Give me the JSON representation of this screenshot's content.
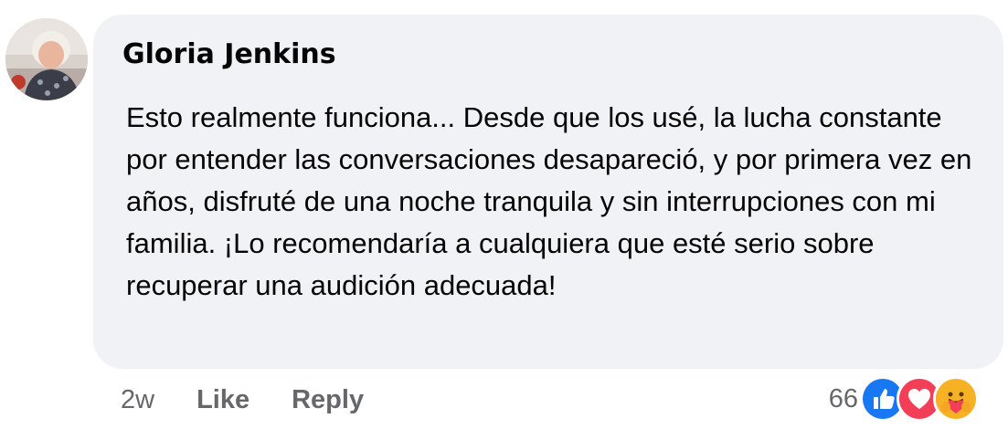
{
  "comment": {
    "author": "Gloria Jenkins",
    "avatar_icon": "profile-photo",
    "text": "Esto realmente funciona... Desde que los usé, la lucha constante por entender las conversaciones desapareció, y por primera vez en años, disfruté de una noche tranquila y sin interrupciones con mi familia. ¡Lo recomendaría a cualquiera que esté serio sobre recuperar una audición adecuada!",
    "timestamp": "2w",
    "like_label": "Like",
    "reply_label": "Reply"
  },
  "reactions": {
    "count": "66",
    "icons": [
      "like-reaction-icon",
      "love-reaction-icon",
      "care-reaction-icon"
    ]
  },
  "colors": {
    "bubble_bg": "#f0f2f5",
    "like_blue": "#1877f2",
    "love_red": "#f33e58",
    "care_yellow": "#f7b125",
    "meta_gray": "#65676b"
  }
}
